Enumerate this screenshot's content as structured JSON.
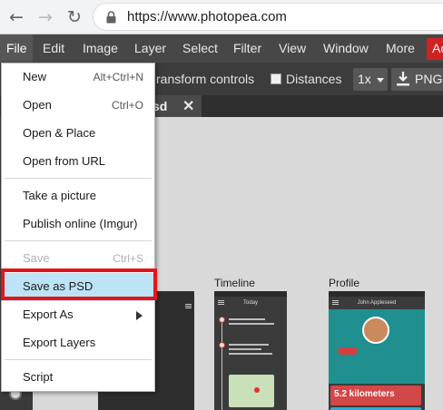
{
  "browser": {
    "url": "https://www.photopea.com",
    "back_icon": "arrow-left-icon",
    "forward_icon": "arrow-right-icon",
    "reload_icon": "reload-icon",
    "lock_icon": "lock-icon"
  },
  "menubar": {
    "items": [
      "File",
      "Edit",
      "Image",
      "Layer",
      "Select",
      "Filter",
      "View",
      "Window",
      "More"
    ],
    "account_label": "Ac"
  },
  "options": {
    "transform_label": "ransform controls",
    "distances_label": "Distances",
    "zoom_value": "1x",
    "export_label": "PNG"
  },
  "tab": {
    "name": "sd",
    "close_label": "✕"
  },
  "canvas": {
    "artboards": [
      "Timeline",
      "Profile"
    ],
    "timeline_header": "Today",
    "profile_header": "John Appleseed",
    "profile_stat": "5.2 kilometers"
  },
  "file_menu": {
    "items": [
      {
        "label": "New",
        "shortcut": "Alt+Ctrl+N"
      },
      {
        "label": "Open",
        "shortcut": "Ctrl+O"
      },
      {
        "label": "Open & Place",
        "shortcut": ""
      },
      {
        "label": "Open from URL",
        "shortcut": ""
      },
      {
        "label": "Take a picture",
        "shortcut": ""
      },
      {
        "label": "Publish online (Imgur)",
        "shortcut": ""
      },
      {
        "label": "Save",
        "shortcut": "Ctrl+S"
      },
      {
        "label": "Save as PSD",
        "shortcut": ""
      },
      {
        "label": "Export As",
        "shortcut": ""
      },
      {
        "label": "Export Layers",
        "shortcut": ""
      },
      {
        "label": "Script",
        "shortcut": ""
      }
    ],
    "highlight_color": "#bde3f7",
    "callout_color": "#e4141b"
  }
}
